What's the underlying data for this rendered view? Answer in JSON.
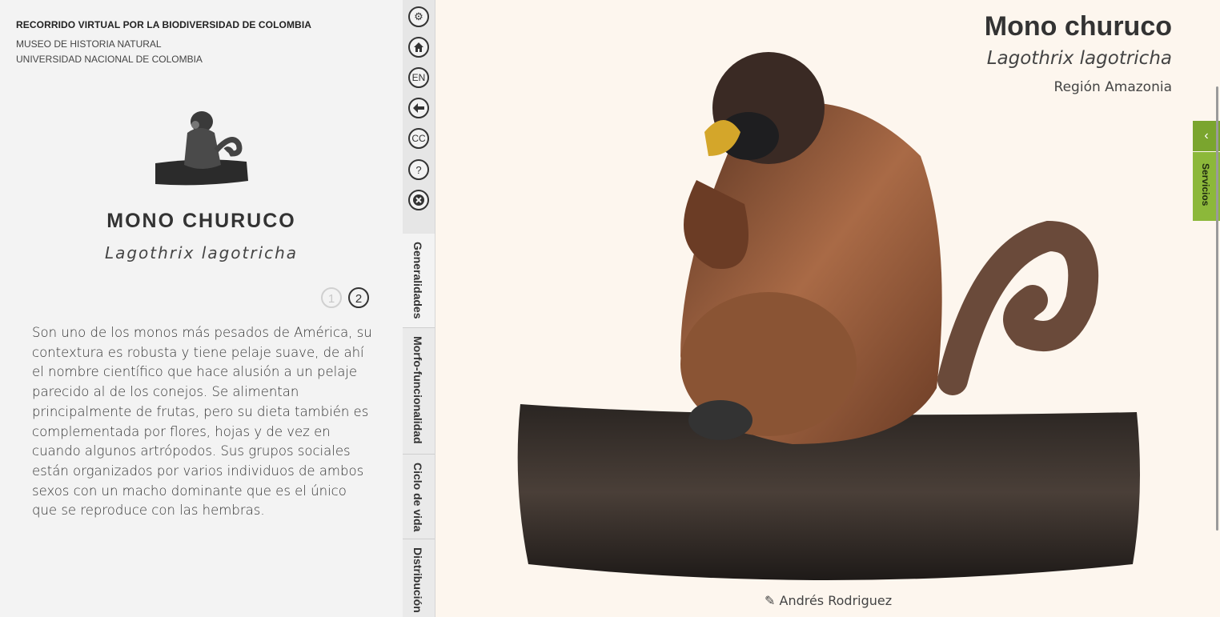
{
  "header": {
    "title": "RECORRIDO VIRTUAL POR LA BIODIVERSIDAD DE COLOMBIA",
    "line1": "MUSEO DE HISTORIA NATURAL",
    "line2": "UNIVERSIDAD NACIONAL DE COLOMBIA"
  },
  "species": {
    "name_caps": "MONO CHURUCO",
    "scientific": "Lagothrix lagotricha",
    "pages": [
      "1",
      "2"
    ],
    "current_page": 2,
    "description": "Son uno de los monos más pesados de América, su contextura es robusta y tiene pelaje suave, de ahí el nombre científico que hace alusión a un pelaje parecido al de los conejos. Se alimentan principalmente de frutas, pero su dieta también es complementada por flores, hojas y de vez en cuando algunos artrópodos. Sus grupos sociales están organizados por varios individuos de ambos sexos con un macho dominante que es el único que se reproduce con las hembras."
  },
  "toolbar": {
    "lang_label": "EN",
    "cc_label": "CC",
    "help_label": "?"
  },
  "tabs": [
    {
      "label": "Generalidades",
      "active": true
    },
    {
      "label": "Morfo-funcionalidad",
      "active": false
    },
    {
      "label": "Ciclo de vida",
      "active": false
    },
    {
      "label": "Distribución",
      "active": false
    }
  ],
  "main": {
    "title": "Mono churuco",
    "scientific": "Lagothrix lagotricha",
    "region": "Región Amazonia",
    "credit": "✎ Andrés Rodriguez"
  },
  "services": {
    "label": "Servicios",
    "toggle_icon": "‹"
  },
  "colors": {
    "accent_green": "#8cb83a",
    "panel_bg": "#f3f3f3",
    "main_bg": "#fdf6ee"
  }
}
